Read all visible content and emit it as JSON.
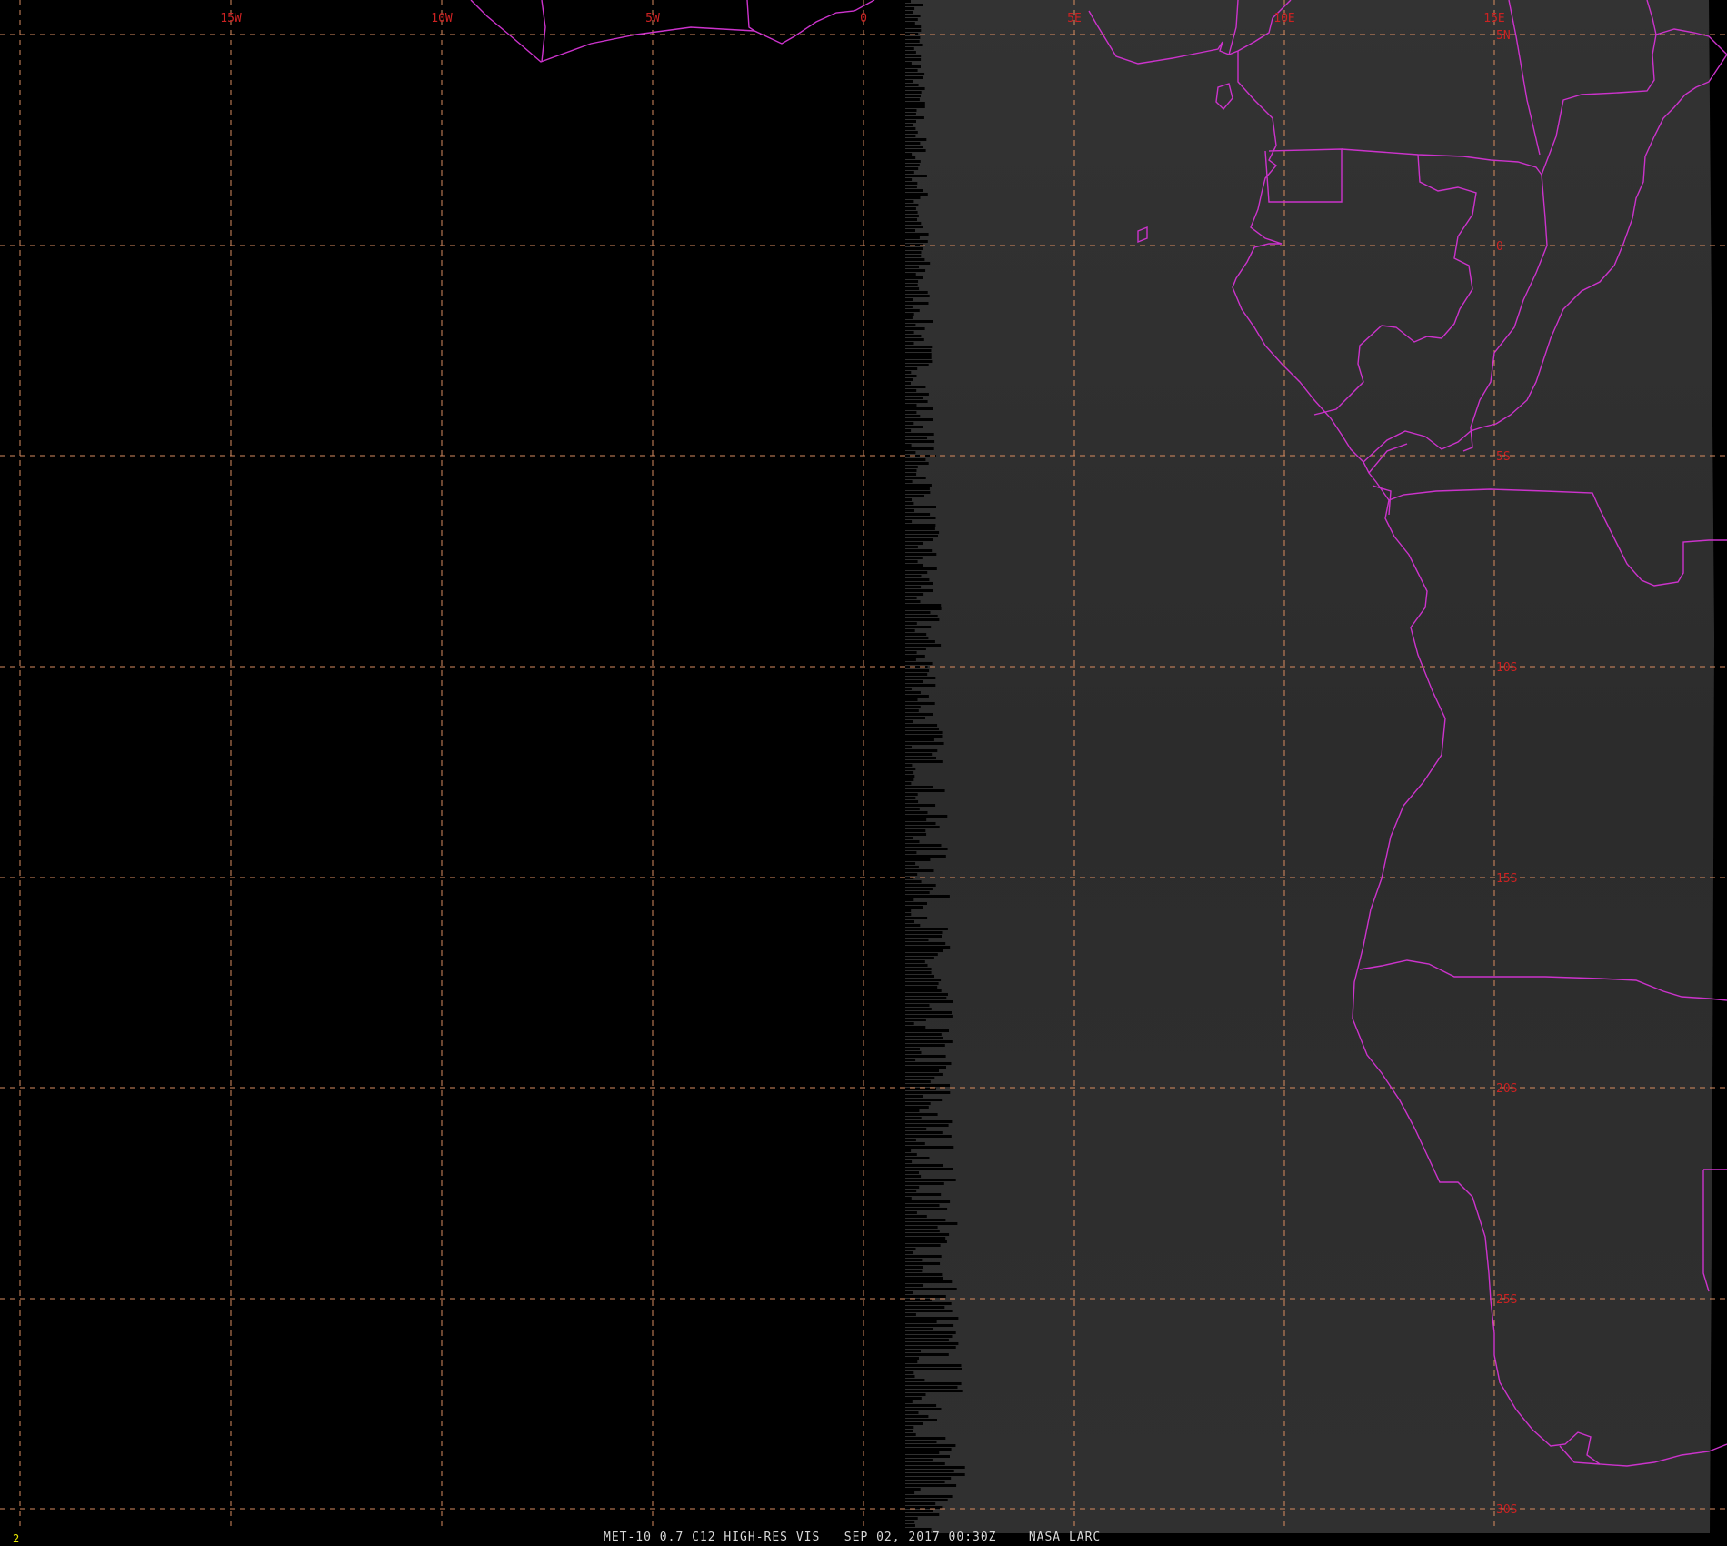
{
  "map": {
    "longitude_labels": [
      "15W",
      "10W",
      "5W",
      "0",
      "5E",
      "10E",
      "15E"
    ],
    "latitude_labels": [
      "5N",
      "0",
      "5S",
      "10S",
      "15S",
      "20S",
      "25S",
      "30S"
    ],
    "colors": {
      "background": "#000000",
      "imagery": "#2e2e2e",
      "coastline": "#cc33cc",
      "gridline": "#d98c5f",
      "grid_label": "#cc2222",
      "footer_text": "#d8d8d8",
      "frame_number": "#e6e600"
    }
  },
  "footer": {
    "frame_number": "2",
    "caption": "MET-10 0.7 C12 HIGH-RES VIS   SEP 02, 2017 00:30Z    NASA LARC"
  }
}
